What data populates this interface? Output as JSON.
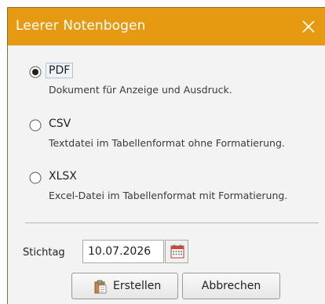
{
  "dialog": {
    "title": "Leerer Notenbogen"
  },
  "options": [
    {
      "label": "PDF",
      "description": "Dokument für Anzeige und Ausdruck.",
      "selected": true
    },
    {
      "label": "CSV",
      "description": "Textdatei im Tabellenformat ohne Formatierung.",
      "selected": false
    },
    {
      "label": "XLSX",
      "description": "Excel-Datei im Tabellenformat mit Formatierung.",
      "selected": false
    }
  ],
  "date": {
    "label": "Stichtag",
    "value": "10.07.2026"
  },
  "buttons": {
    "create": "Erstellen",
    "cancel": "Abbrechen"
  },
  "colors": {
    "titlebar": "#e69a12",
    "radio_selected": "#1f1f1f",
    "calendar_icon": "#c0392b"
  },
  "icons": {
    "close": "close-icon",
    "calendar": "calendar-icon",
    "create": "clipboard-icon"
  }
}
